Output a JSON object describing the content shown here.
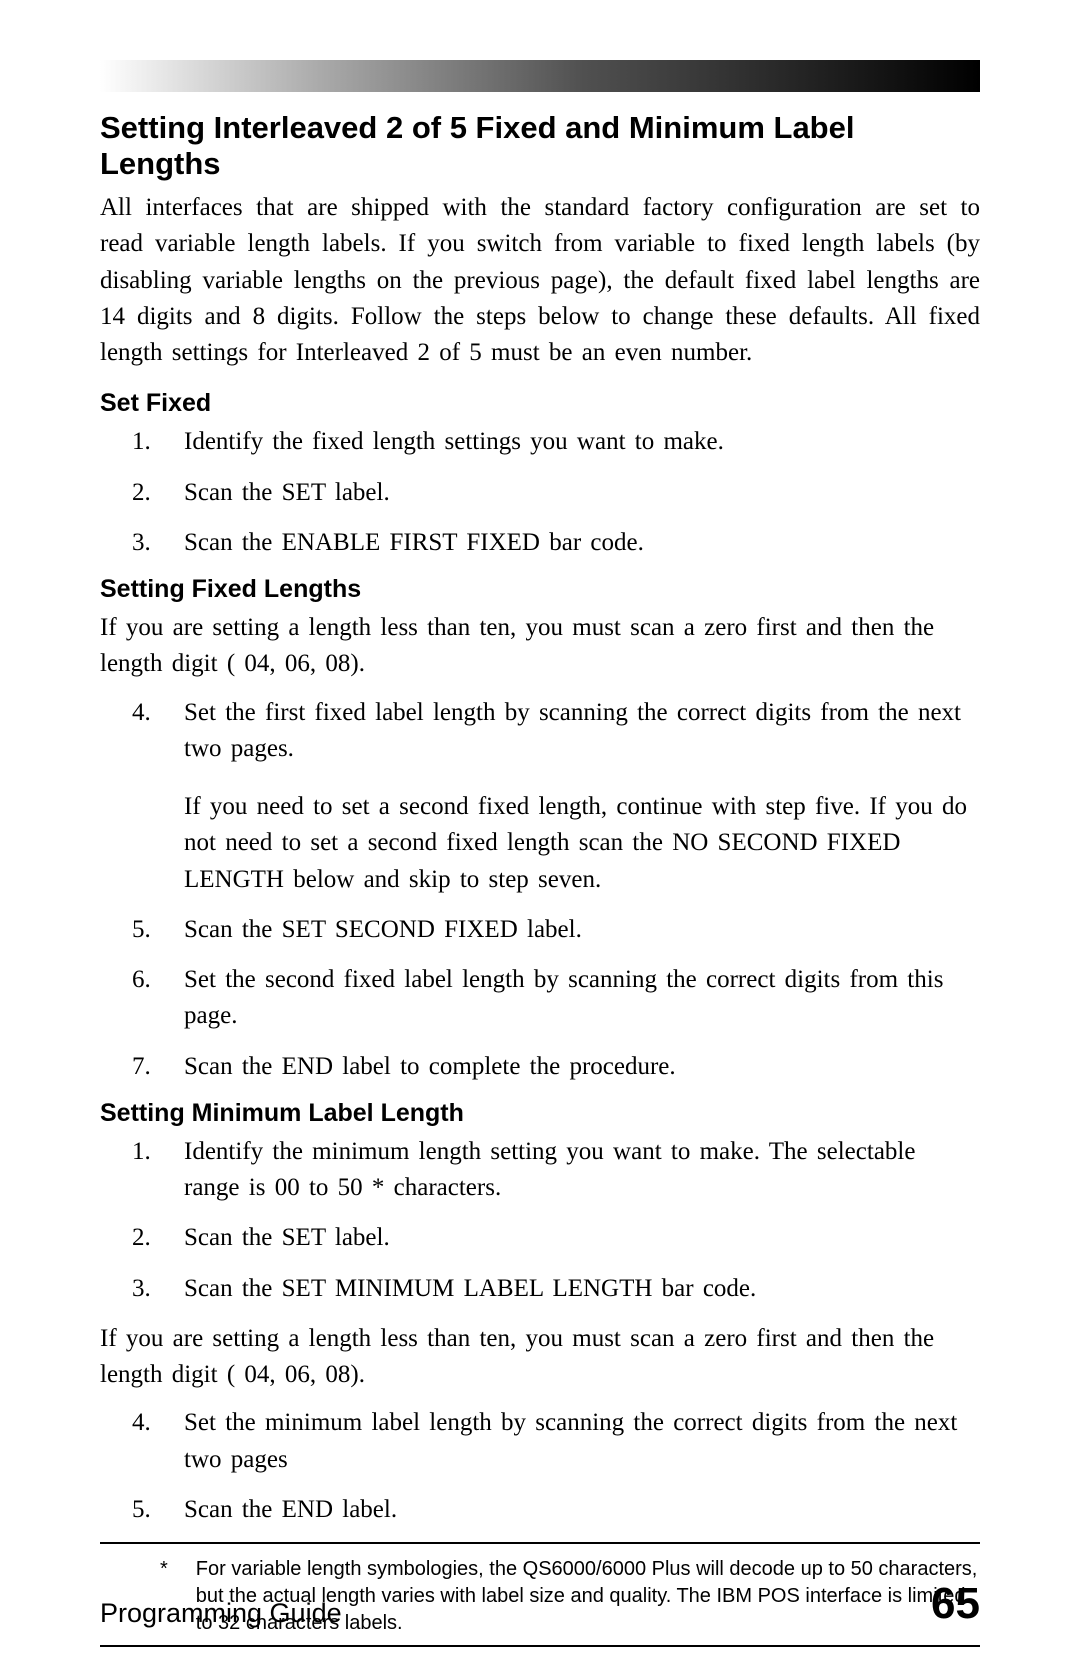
{
  "heading": "Setting Interleaved 2 of 5 Fixed and Minimum Label Lengths",
  "intro": "All interfaces that are shipped with the standard factory configuration are set to read variable length labels.  If you switch from variable to fixed length labels (by disabling variable lengths on the previous page), the default fixed label lengths are 14 digits and 8 digits.  Follow the steps below to change these defaults.  All fixed length settings for Interleaved 2 of 5 must be an even number.",
  "set_fixed": {
    "title": "Set Fixed",
    "items": [
      "Identify the fixed length settings you want to make.",
      "Scan  the  SET  label.",
      "Scan the ENABLE FIRST FIXED bar code."
    ]
  },
  "setting_fixed_lengths": {
    "title": "Setting Fixed Lengths",
    "lead": "If you are setting a length less than ten, you must scan a zero first and then the length digit ( 04, 06, 08).",
    "items": [
      {
        "text": "Set the first fixed label length by scanning the correct digits from the next two pages.",
        "extra": "If you need to set a second fixed length, continue with step five.  If you do not need to set a second fixed length scan the NO SECOND FIXED LENGTH below and skip to step seven."
      },
      {
        "text": "Scan the SET SECOND FIXED label."
      },
      {
        "text": "Set the second fixed label length by scanning the correct digits from this page."
      },
      {
        "text": "Scan the END label to complete the procedure."
      }
    ]
  },
  "setting_min": {
    "title": "Setting Minimum Label Length",
    "items_a": [
      "Identify the minimum length setting you want to make. The selectable range is 00 to 50 * characters.",
      "Scan  the  SET  label.",
      "Scan the SET MINIMUM LABEL LENGTH bar code."
    ],
    "mid": "If you are setting a length less than ten, you must scan a zero first and then the length digit ( 04, 06, 08).",
    "items_b": [
      "Set the minimum label length by scanning the correct digits from the next two pages",
      "Scan  the  END  label."
    ]
  },
  "footnote": {
    "mark": "*",
    "text": "For variable length symbologies, the QS6000/6000 Plus will decode up to 50 characters, but the actual length varies with label size and quality.  The IBM POS interface is limited to 32 characters labels."
  },
  "footer": {
    "left": "Programming Guide",
    "page": "65"
  }
}
